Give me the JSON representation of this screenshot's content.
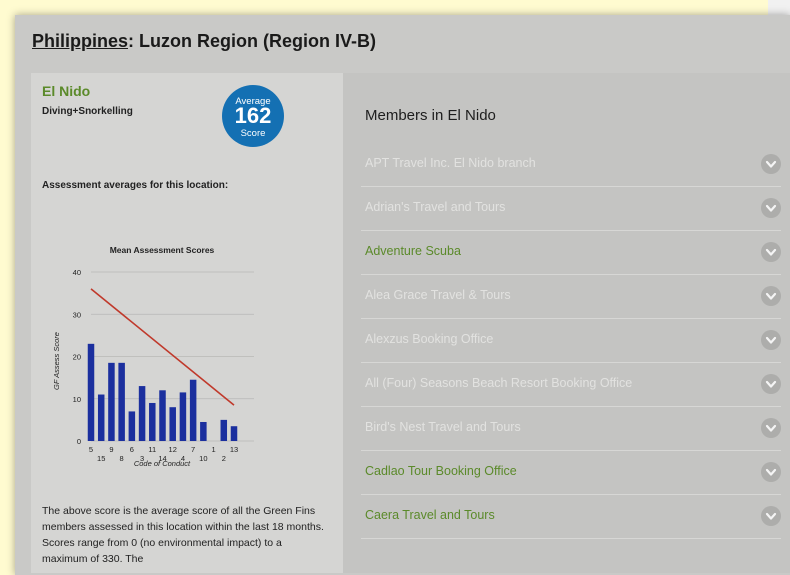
{
  "header": {
    "country": "Philippines",
    "separator": ":",
    "region": " Luzon Region (Region IV-B)"
  },
  "location": {
    "name": "El Nido",
    "activity": "Diving+Snorkelling",
    "badge": {
      "top": "Average",
      "score": "162",
      "bottom": "Score"
    },
    "assessment_heading": "Assessment averages for this location:",
    "description": "The above score is the average score of all the Green Fins members assessed in this location within the last 18 months. Scores range from 0 (no environmental impact) to a maximum of 330. The"
  },
  "chart_data": {
    "type": "bar",
    "title": "Mean Assessment Scores",
    "xlabel": "Code of Conduct",
    "ylabel": "GF Assess Score",
    "ylim": [
      0,
      40
    ],
    "yticks": [
      0,
      10,
      20,
      30,
      40
    ],
    "grid": true,
    "categories": [
      "5",
      "15",
      "9",
      "8",
      "6",
      "3",
      "11",
      "14",
      "12",
      "4",
      "7",
      "10",
      "1",
      "2",
      "13"
    ],
    "values": [
      23,
      11,
      18.5,
      18.5,
      7,
      13,
      9,
      12,
      8,
      11.5,
      14.5,
      4.5,
      0,
      5,
      3.5
    ],
    "trendline": {
      "start": 36,
      "end": 8.5
    },
    "colors": {
      "bar": "#1b2f9e",
      "trend": "#c0392b"
    }
  },
  "members": {
    "title": "Members in El Nido",
    "items": [
      {
        "name": "APT Travel Inc. El Nido branch",
        "active": false
      },
      {
        "name": "Adrian's Travel and Tours",
        "active": false
      },
      {
        "name": "Adventure Scuba",
        "active": true
      },
      {
        "name": "Alea Grace Travel & Tours",
        "active": false
      },
      {
        "name": "Alexzus Booking Office",
        "active": false
      },
      {
        "name": "All (Four) Seasons Beach Resort Booking Office",
        "active": false
      },
      {
        "name": "Bird's Nest Travel and Tours",
        "active": false
      },
      {
        "name": "Cadlao Tour Booking Office",
        "active": true
      },
      {
        "name": "Caera Travel and Tours",
        "active": true
      }
    ]
  }
}
